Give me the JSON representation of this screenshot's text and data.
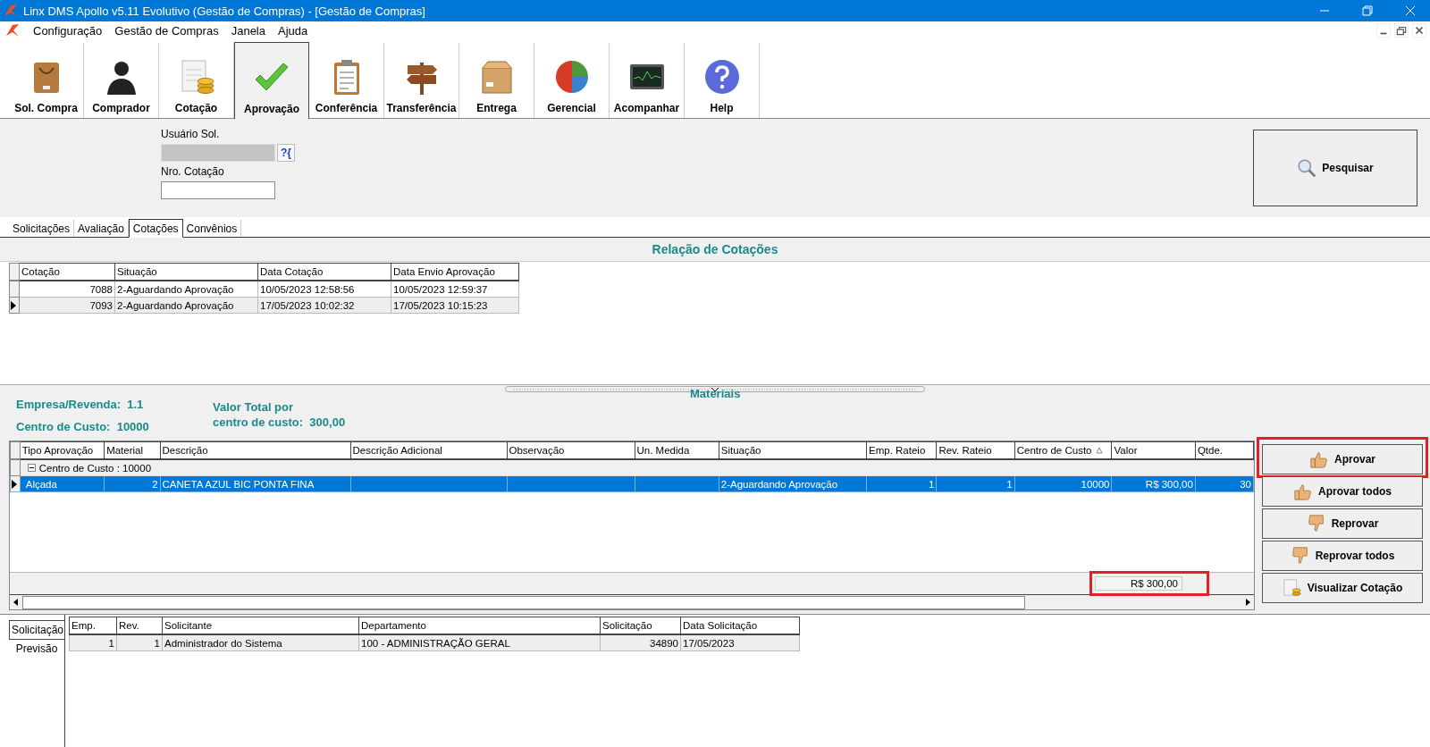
{
  "window": {
    "title": "Linx DMS Apollo v5.11 Evolutivo (Gestão de Compras) - [Gestão de Compras]"
  },
  "menu": [
    "Configuração",
    "Gestão de Compras",
    "Janela",
    "Ajuda"
  ],
  "toolbar": [
    {
      "label": "Sol. Compra",
      "selected": false
    },
    {
      "label": "Comprador",
      "selected": false
    },
    {
      "label": "Cotação",
      "selected": false
    },
    {
      "label": "Aprovação",
      "selected": true
    },
    {
      "label": "Conferência",
      "selected": false
    },
    {
      "label": "Transferência",
      "selected": false
    },
    {
      "label": "Entrega",
      "selected": false
    },
    {
      "label": "Gerencial",
      "selected": false
    },
    {
      "label": "Acompanhar",
      "selected": false
    },
    {
      "label": "Help",
      "selected": false
    }
  ],
  "filters": {
    "user_label": "Usuário Sol.",
    "lookup": "?{",
    "quote_label": "Nro. Cotação"
  },
  "search_button": "Pesquisar",
  "tabs": [
    {
      "label": "Solicitações",
      "selected": false
    },
    {
      "label": "Avaliação",
      "selected": false
    },
    {
      "label": "Cotações",
      "selected": true
    },
    {
      "label": "Convênios",
      "selected": false
    }
  ],
  "quotes": {
    "title": "Relação de Cotações",
    "columns": [
      "Cotação",
      "Situação",
      "Data Cotação",
      "Data Envio Aprovação"
    ],
    "rows": [
      {
        "cells": [
          "7088",
          "2-Aguardando Aprovação",
          "10/05/2023 12:58:56",
          "10/05/2023 12:59:37"
        ],
        "selected": false
      },
      {
        "cells": [
          "7093",
          "2-Aguardando Aprovação",
          "17/05/2023 10:02:32",
          "17/05/2023 10:15:23"
        ],
        "selected": true
      }
    ]
  },
  "materials": {
    "title": "Materiais",
    "company_label": "Empresa/Revenda:",
    "company_value": "1.1",
    "cost_center_label": "Centro de Custo:",
    "cost_center_value": "10000",
    "total_label": [
      "Valor Total por",
      "centro de custo:"
    ],
    "total_value": "300,00",
    "columns": [
      {
        "label": "Tipo Aprovação",
        "sorted": false
      },
      {
        "label": "Material",
        "sorted": false
      },
      {
        "label": "Descrição",
        "sorted": false
      },
      {
        "label": "Descrição Adicional",
        "sorted": false
      },
      {
        "label": "Observação",
        "sorted": false
      },
      {
        "label": "Un. Medida",
        "sorted": false
      },
      {
        "label": "Situação",
        "sorted": false
      },
      {
        "label": "Emp. Rateio",
        "sorted": false
      },
      {
        "label": "Rev. Rateio",
        "sorted": false
      },
      {
        "label": "Centro de Custo",
        "sorted": true
      },
      {
        "label": "Valor",
        "sorted": false
      },
      {
        "label": "Qtde.",
        "sorted": false
      }
    ],
    "group": {
      "label": "Centro de Custo : 10000",
      "expanded": true
    },
    "rows": [
      {
        "cells": [
          "Alçada",
          "2",
          "CANETA AZUL BIC PONTA FINA",
          "",
          "",
          "",
          "2-Aguardando Aprovação",
          "1",
          "1",
          "10000",
          "R$ 300,00",
          "30"
        ],
        "selected": true
      }
    ],
    "footer_total": {
      "text": "R$ 300,00",
      "highlighted": true
    }
  },
  "actions": [
    {
      "label": "Aprovar",
      "highlighted": true
    },
    {
      "label": "Aprovar todos",
      "highlighted": false
    },
    {
      "label": "Reprovar",
      "highlighted": false
    },
    {
      "label": "Reprovar todos",
      "highlighted": false
    },
    {
      "label": "Visualizar Cotação",
      "highlighted": false
    }
  ],
  "detail": {
    "side_tabs": [
      {
        "label": "Solicitação",
        "selected": true
      },
      {
        "label": "Previsão",
        "selected": false
      }
    ],
    "columns": [
      "Emp.",
      "Rev.",
      "Solicitante",
      "Departamento",
      "Solicitação",
      "Data Solicitação"
    ],
    "rows": [
      [
        "1",
        "1",
        "Administrador do Sistema",
        "100 - ADMINISTRAÇÃO GERAL",
        "34890",
        "17/05/2023"
      ]
    ]
  }
}
